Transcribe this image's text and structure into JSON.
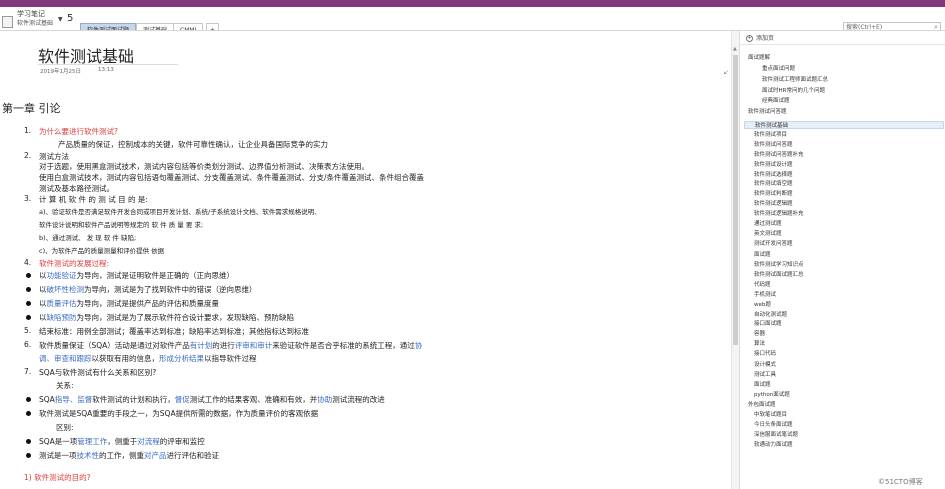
{
  "header": {
    "notebook_title": "学习笔记",
    "notebook_subtitle": "软件测试基础",
    "page_count": "5",
    "search_placeholder": "搜索(Ctrl+E)"
  },
  "tabs": [
    "软件测试面试题",
    "测试基础",
    "CMMI",
    "+"
  ],
  "page": {
    "title": "软件测试基础",
    "date": "2019年1月25日",
    "time": "13:13",
    "chapter": "第一章  引论"
  },
  "content": {
    "n1": "1.",
    "l1": "为什么要进行软件测试?",
    "l1a": "产品质量的保证，控制成本的关键，软件可靠性确认，让企业具备国际竞争的实力",
    "n2": "2.",
    "l2": "测试方法",
    "l2a": "对于选题，使用黑盒测试技术，测试内容包括等价类划分测试、边界值分析测试、决策表方法使用。",
    "l2b": "使用白盒测试技术，测试内容包括语句覆盖测试、分支覆盖测试、条件覆盖测试、分支/条件覆盖测试、条件组合覆盖",
    "l2c": "测试及基本路径测试。",
    "n3": "3.",
    "l3": "计 算 机 软 件 的 测 试 目 的 是:",
    "l3a": "a)、验证软件是否满足软件开发合同或项目开发计划、系统/子系统设计文档、软件需求规格说明、",
    "l3b": "软件设计说明和软件产品说明等规定的 软 件 质 量 要 求;",
    "l3c": "b)、通过测试、 发 现 软 件 缺陷;",
    "l3d": "c)、为软件产品的质量测量和评价提供 依据",
    "n4": "4.",
    "l4": "软件测试的发展过程:",
    "b1a": "以",
    "b1b": "功能验证",
    "b1c": "为导向，测试是证明软件是正确的（正向思维）",
    "b2a": "以",
    "b2b": "破坏性检测",
    "b2c": "为导向，测试是为了找到软件中的错误（逆向思维）",
    "b3a": "以",
    "b3b": "质量评估",
    "b3c": "为导向，测试是提供产品的评估和质量度量",
    "b4a": "以",
    "b4b": "缺陷预防",
    "b4c": "为导向，测试是为了展示软件符合设计要求，发现缺陷、预防缺陷",
    "n5": "5.",
    "l5": "结束标准：用例全部测试；覆盖率达到标准；缺陷率达到标准；其他指标达到标准",
    "n6": "6.",
    "l6a": "软件质量保证（SQA）活动是通过对软件产品",
    "l6b": "有计划",
    "l6c": "的进行",
    "l6d": "评审和审计",
    "l6e": "来验证软件是否合乎标准的系统工程，通过",
    "l6f": "协",
    "l6g": "调、审查和跟踪",
    "l6h": "以获取有用的信息，",
    "l6i": "形成分析结果",
    "l6j": "以指导软件过程",
    "n7": "7.",
    "l7": "SQA与软件测试有什么关系和区别?",
    "l7a": "关系:",
    "b5a": "SQA",
    "b5b": "指导、监督",
    "b5c": "软件测试的计划和执行，",
    "b5d": "督促",
    "b5e": "测试工作的结果客观、准确和有效，并",
    "b5f": "协助",
    "b5g": "测试流程的改进",
    "b6": "软件测试是SQA重要的手段之一，为SQA提供所需的数据，作为质量评价的客观依据",
    "l7b": "区别:",
    "b7a": "SQA是一项",
    "b7b": "管理工作",
    "b7c": "，侧重于",
    "b7d": "对流程",
    "b7e": "的评审和监控",
    "b8a": "测试是一项",
    "b8b": "技术性",
    "b8c": "的工作，侧重",
    "b8d": "对产品",
    "b8e": "进行评估和验证",
    "l8": "1)   软件测试的目的?"
  },
  "panel": {
    "add_page": "添加页",
    "items": [
      "面试题解",
      "重点面试问题",
      "软件测试工程师面试题汇总",
      "面试时HR常问的几个问题",
      "经典面试题",
      "软件测试问答题",
      "软件测试基础",
      "软件测试项目",
      "软件测试问答题",
      "软件测试问答题补充",
      "软件测试设计题",
      "软件测试选择题",
      "软件测试填空题",
      "软件测试判断题",
      "软件测试逻辑题",
      "软件测试逻辑题补充",
      "通过测试题",
      "英文测试题",
      "测试开发问答题",
      "面试题",
      "软件测试学习知识点",
      "软件测试面试题汇总",
      "代码题",
      "手机测试",
      "web题",
      "自动化测试题",
      "接口面试题",
      "容器",
      "算法",
      "接口代码",
      "设计模式",
      "测试工具",
      "面试题",
      "python面试题",
      "外包面试题",
      "中软笔试题目",
      "今日头条面试题",
      "深信服面试笔试题",
      "软通动力面试题"
    ]
  },
  "watermark": "©51CTO博客"
}
